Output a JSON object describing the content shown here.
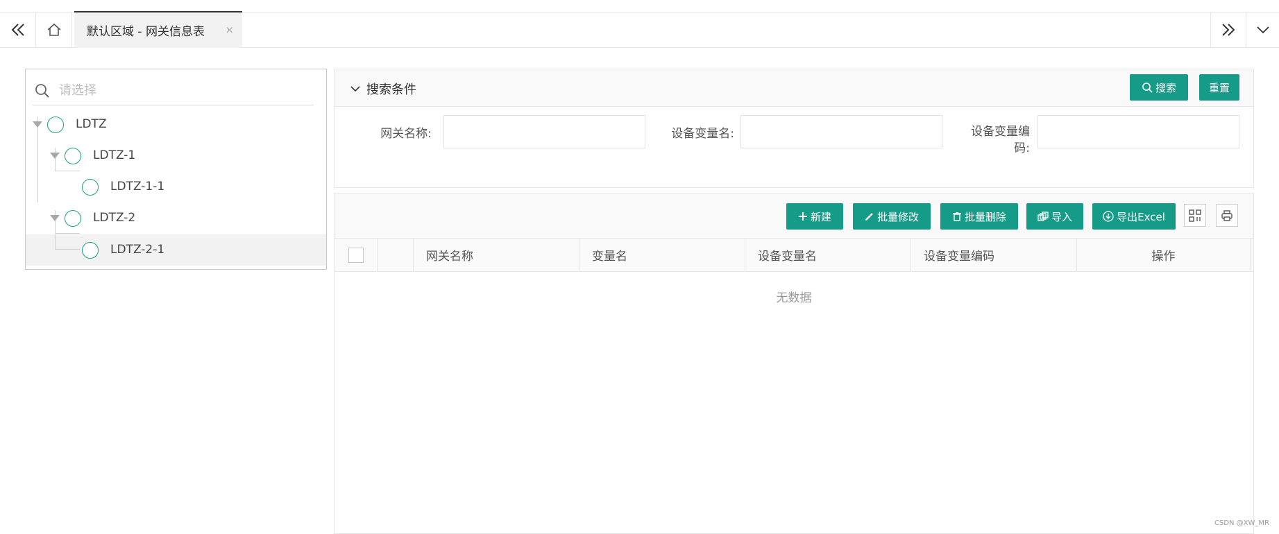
{
  "tabbar": {
    "active_tab": "默认区域 - 网关信息表",
    "close_glyph": "×"
  },
  "tree": {
    "search_placeholder": "请选择",
    "nodes": [
      {
        "label": "LDTZ"
      },
      {
        "label": "LDTZ-1"
      },
      {
        "label": "LDTZ-1-1"
      },
      {
        "label": "LDTZ-2"
      },
      {
        "label": "LDTZ-2-1"
      }
    ],
    "accent_color": "#16a085"
  },
  "search": {
    "title": "搜索条件",
    "search_button": "搜索",
    "reset_button": "重置",
    "fields": [
      {
        "label": "网关名称:",
        "value": ""
      },
      {
        "label": "设备变量名:",
        "value": ""
      },
      {
        "label": "设备变量编",
        "label_line2": "码:",
        "value": ""
      }
    ]
  },
  "toolbar": {
    "new": "新建",
    "batch_edit": "批量修改",
    "batch_delete": "批量删除",
    "import": "导入",
    "export": "导出Excel"
  },
  "table": {
    "columns": [
      "网关名称",
      "变量名",
      "设备变量名",
      "设备变量编码",
      "操作"
    ],
    "rows": [],
    "empty_text": "无数据"
  },
  "theme": {
    "primary": "#169b88"
  },
  "watermark": "CSDN @XW_MR"
}
